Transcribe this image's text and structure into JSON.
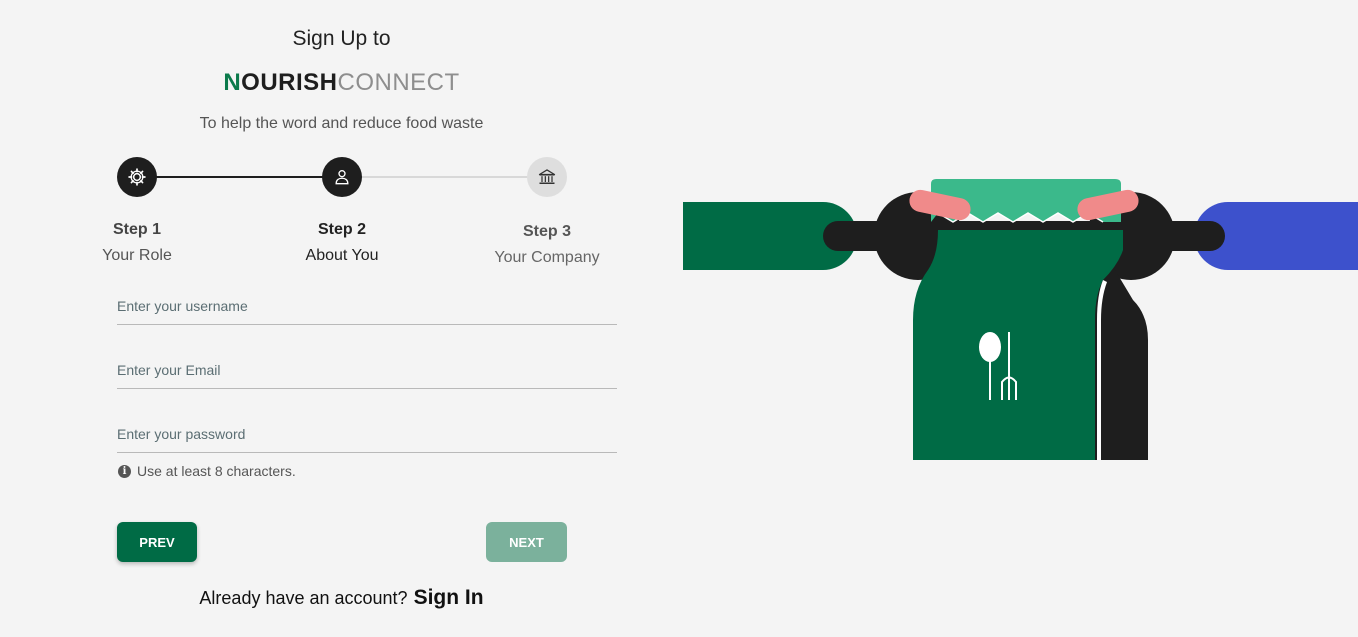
{
  "header": {
    "title": "Sign Up to",
    "brand": {
      "first_letter": "N",
      "bold_part": "OURISH",
      "light_part": "CONNECT"
    },
    "tagline": "To help the word and reduce food waste"
  },
  "stepper": {
    "steps": [
      {
        "title": "Step 1",
        "label": "Your Role",
        "icon": "gear-icon",
        "state": "completed"
      },
      {
        "title": "Step 2",
        "label": "About You",
        "icon": "person-icon",
        "state": "active"
      },
      {
        "title": "Step 3",
        "label": "Your Company",
        "icon": "building-icon",
        "state": "pending"
      }
    ]
  },
  "form": {
    "username": {
      "placeholder": "Enter your username",
      "value": ""
    },
    "email": {
      "placeholder": "Enter your Email",
      "value": ""
    },
    "password": {
      "placeholder": "Enter your password",
      "value": ""
    },
    "password_hint": "Use at least 8 characters."
  },
  "buttons": {
    "prev": "PREV",
    "next": "NEXT"
  },
  "footer": {
    "prompt": "Already have an account?",
    "signin_link": "Sign In"
  },
  "colors": {
    "brand_green": "#006b45",
    "brand_green_light": "#0b7a4b",
    "next_disabled": "#7bb19c",
    "dark": "#1e1e1e",
    "accent_blue": "#3d51cc",
    "accent_pink": "#f08a8a",
    "accent_mint": "#3bb98b"
  }
}
